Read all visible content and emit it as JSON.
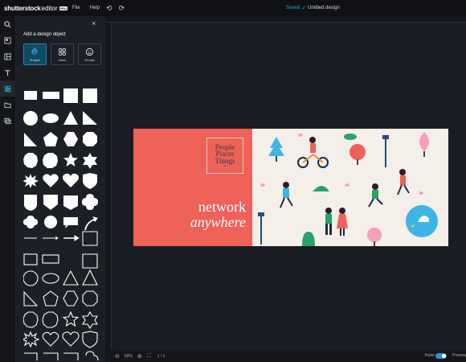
{
  "topbar": {
    "brand_name": "shutterstock",
    "brand_suffix": "editor",
    "brand_badge": "PRO",
    "menu_file": "File",
    "menu_help": "Help",
    "save_status": "Saved",
    "document_title": "Untitled design"
  },
  "rail": {
    "items": [
      "search-icon",
      "templates-icon",
      "layouts-icon",
      "text-icon",
      "design-objects-icon",
      "folder-icon",
      "layers-icon"
    ],
    "active": "design-objects-icon"
  },
  "panel": {
    "title": "Add a design object",
    "close": "×",
    "tabs": [
      {
        "label": "Shapes",
        "active": true
      },
      {
        "label": "Icons",
        "active": false
      },
      {
        "label": "Emojis",
        "active": false
      }
    ],
    "shape_color": "#ffffff"
  },
  "banner": {
    "logo_lines": [
      "People",
      "Places",
      "Things"
    ],
    "logo_small": "inc.",
    "headline_line1": "network",
    "headline_line2": "anywhere",
    "left_color": "#ee625a",
    "right_color": "#f4efe9"
  },
  "bottombar": {
    "zoom": "59%",
    "page": "1 / 1",
    "ruler_label": "Ruler",
    "ruler_on": true,
    "preview_label": "Preview"
  }
}
